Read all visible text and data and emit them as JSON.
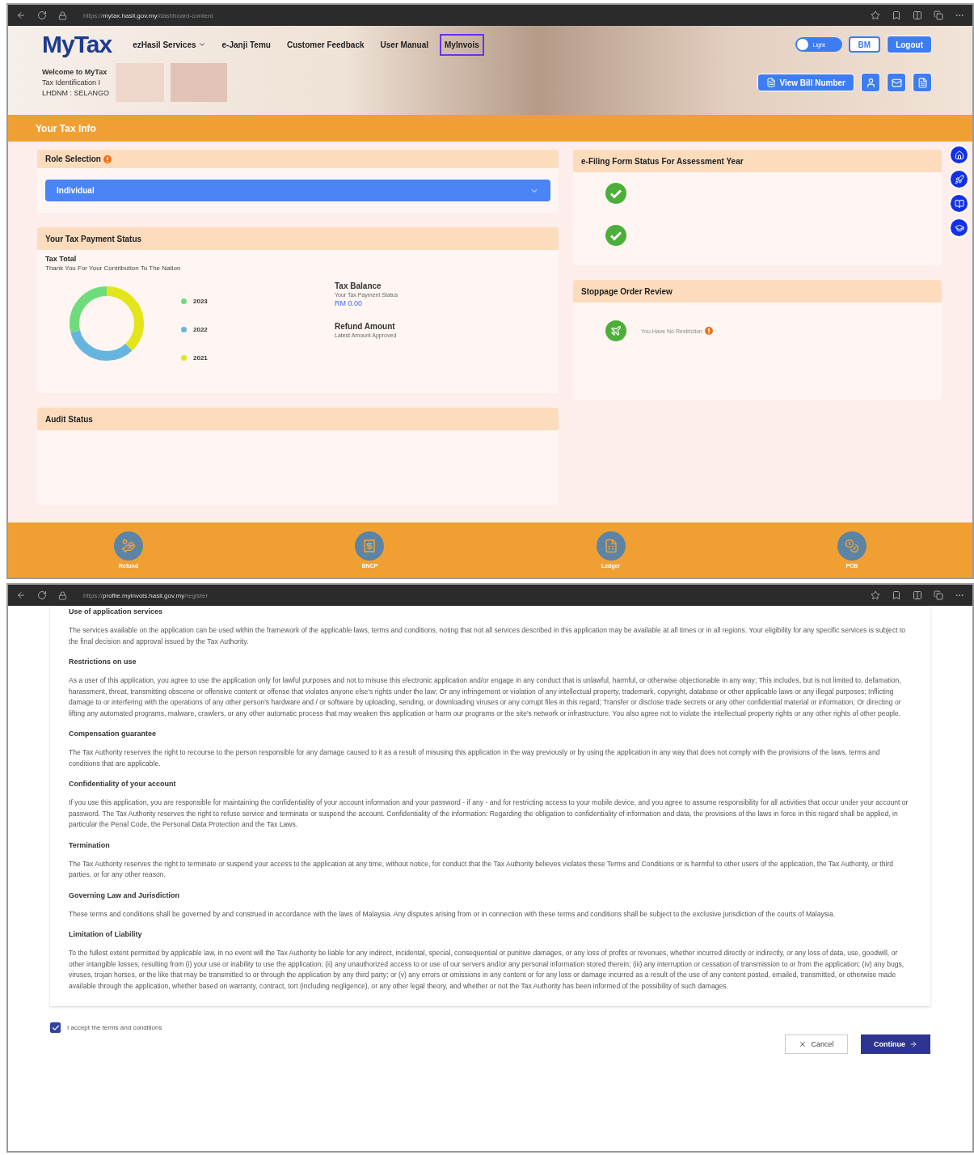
{
  "dashboard_window": {
    "url": "https://**mytax.hasil.gov.my**/dashboard-content",
    "header": {
      "logo": "MyTax",
      "nav": [
        {
          "label": "ezHasil Services",
          "has_menu": true,
          "selected": false
        },
        {
          "label": "e-Janji Temu",
          "has_menu": false,
          "selected": false
        },
        {
          "label": "Customer Feedback",
          "has_menu": false,
          "selected": false
        },
        {
          "label": "User Manual",
          "has_menu": false,
          "selected": false
        },
        {
          "label": "MyInvois",
          "has_menu": false,
          "selected": true
        }
      ],
      "theme_toggle": "Light",
      "language": "BM",
      "logout": "Logout",
      "welcome": [
        "Welcome to MyTax",
        "Tax Identification I",
        "LHDNM : SELANGO"
      ],
      "bill_button": "View Bill Number"
    },
    "section_title": "Your Tax Info",
    "role_selection": {
      "title": "Role Selection",
      "value": "Individual"
    },
    "tax_payment": {
      "title": "Your Tax Payment Status",
      "heading": "Tax Total",
      "subtitle": "Thank You For Your Contribution To The Nation",
      "legend": [
        {
          "label": "2023",
          "color": "#6fdc7c"
        },
        {
          "label": "2022",
          "color": "#66b5e0"
        },
        {
          "label": "2021",
          "color": "#e4e41a"
        }
      ],
      "balance_title": "Tax Balance",
      "balance_caption": "Your Tax Payment Status",
      "balance_value": "RM 0.00",
      "refund_title": "Refund Amount",
      "refund_caption": "Latest Amount Approved"
    },
    "audit_status": {
      "title": "Audit Status"
    },
    "efiling": {
      "title": "e-Filing Form Status For Assessment Year",
      "rows": [
        {
          "done": true
        },
        {
          "done": true
        }
      ]
    },
    "stoppage": {
      "title": "Stoppage Order Review",
      "message": "You Have No Restriction"
    },
    "bottom_bar": [
      {
        "label": "Refund",
        "kind": "refund"
      },
      {
        "label": "BNCP",
        "kind": "bncp"
      },
      {
        "label": "Ledger",
        "kind": "ledger"
      },
      {
        "label": "PCB",
        "kind": "pcb"
      }
    ]
  },
  "terms_window": {
    "url": "https://**profile.myinvois.hasil.gov.my**/register",
    "sections": [
      {
        "heading": "Use of application services",
        "body": "The services available on the application can be used within the framework of the applicable laws, terms and conditions, noting that not all services described in this application may be available at all times or in all regions. Your eligibility for any specific services is subject to the final decision and approval issued by the Tax Authority."
      },
      {
        "heading": "Restrictions on use",
        "body": "As a user of this application, you agree to use the application only for lawful purposes and not to misuse this electronic application and/or engage in any conduct that is unlawful, harmful, or otherwise objectionable in any way; This includes, but is not limited to, defamation, harassment, threat, transmitting obscene or offensive content or offense that violates anyone else's rights under the law; Or any infringement or violation of any intellectual property, trademark, copyright, database or other applicable laws or any illegal purposes; Inflicting damage to or interfering with the operations of any other person's hardware and / or software by uploading, sending, or downloading viruses or any corrupt files in this regard; Transfer or disclose trade secrets or any other confidential material or information; Or directing or lifting any automated programs, malware, crawlers, or any other automatic process that may weaken this application or harm our programs or the site's network or infrastructure. You also agree not to violate the intellectual property rights or any other rights of other people."
      },
      {
        "heading": "Compensation guarantee",
        "body": "The Tax Authority reserves the right to recourse to the person responsible for any damage caused to it as a result of misusing this application in the way previously or by using the application in any way that does not comply with the provisions of the laws, terms and conditions that are applicable."
      },
      {
        "heading": "Confidentiality of your account",
        "body": "If you use this application, you are responsible for maintaining the confidentiality of your account information and your password - if any - and for restricting access to your mobile device, and you agree to assume responsibility for all activities that occur under your account or password. The Tax Authority reserves the right to refuse service and terminate or suspend the account. Confidentiality of the information: Regarding the obligation to confidentiality of information and data, the provisions of the laws in force in this regard shall be applied, in particular the Penal Code, the Personal Data Protection and the Tax Laws."
      },
      {
        "heading": "Termination",
        "body": "The Tax Authority reserves the right to terminate or suspend your access to the application at any time, without notice, for conduct that the Tax Authority believes violates these Terms and Conditions or is harmful to other users of the application, the Tax Authority, or third parties, or for any other reason."
      },
      {
        "heading": "Governing Law and Jurisdiction",
        "body": "These terms and conditions shall be governed by and construed in accordance with the laws of Malaysia. Any disputes arising from or in connection with these terms and conditions shall be subject to the exclusive jurisdiction of the courts of Malaysia."
      },
      {
        "heading": "Limitation of Liability",
        "body": "To the fullest extent permitted by applicable law, in no event will the Tax Authority be liable for any indirect, incidental, special, consequential or punitive damages, or any loss of profits or revenues, whether incurred directly or indirectly, or any loss of data, use, goodwill, or other intangible losses, resulting from (i) your use or inability to use the application; (ii) any unauthorized access to or use of our servers and/or any personal information stored therein; (iii) any interruption or cessation of transmission to or from the application; (iv) any bugs, viruses, trojan horses, or the like that may be transmitted to or through the application by any third party; or (v) any errors or omissions in any content or for any loss or damage incurred as a result of the use of any content posted, emailed, transmitted, or otherwise made available through the application, whether based on warranty, contract, tort (including negligence), or any other legal theory, and whether or not the Tax Authority has been informed of the possibility of such damages."
      }
    ],
    "accept": {
      "label": "I accept the terms and conditions",
      "checked": true
    },
    "cancel": "Cancel",
    "continue": "Continue"
  }
}
